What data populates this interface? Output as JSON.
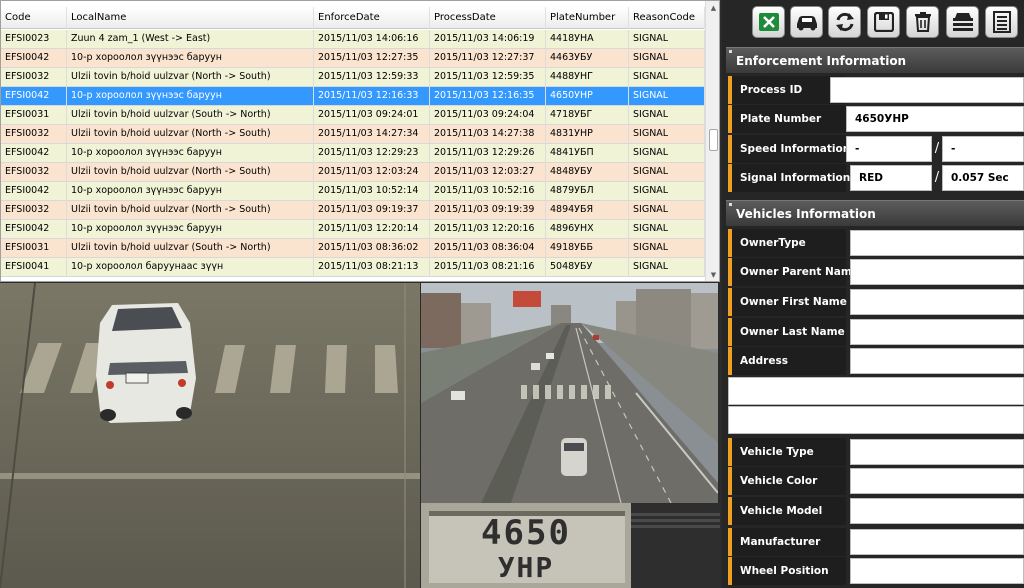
{
  "table": {
    "columns": [
      "Code",
      "LocalName",
      "EnforceDate",
      "ProcessDate",
      "PlateNumber",
      "ReasonCode"
    ],
    "rows": [
      [
        "EFSI0023",
        "Zuun 4 zam_1 (West -> East)",
        "2015/11/03 14:06:16",
        "2015/11/03 14:06:19",
        "4418УНА",
        "SIGNAL"
      ],
      [
        "EFSI0042",
        "10-р хороолол зүүнээс баруун",
        "2015/11/03 12:27:35",
        "2015/11/03 12:27:37",
        "4463УБУ",
        "SIGNAL"
      ],
      [
        "EFSI0032",
        "Ulzii tovin b/hoid uulzvar (North -> South)",
        "2015/11/03 12:59:33",
        "2015/11/03 12:59:35",
        "4488УНГ",
        "SIGNAL"
      ],
      [
        "EFSI0042",
        "10-р хороолол зүүнээс баруун",
        "2015/11/03 12:16:33",
        "2015/11/03 12:16:35",
        "4650УНР",
        "SIGNAL"
      ],
      [
        "EFSI0031",
        "Ulzii tovin b/hoid uulzvar (South -> North)",
        "2015/11/03 09:24:01",
        "2015/11/03 09:24:04",
        "4718УБГ",
        "SIGNAL"
      ],
      [
        "EFSI0032",
        "Ulzii tovin b/hoid uulzvar (North -> South)",
        "2015/11/03 14:27:34",
        "2015/11/03 14:27:38",
        "4831УНР",
        "SIGNAL"
      ],
      [
        "EFSI0042",
        "10-р хороолол зүүнээс баруун",
        "2015/11/03 12:29:23",
        "2015/11/03 12:29:26",
        "4841УБП",
        "SIGNAL"
      ],
      [
        "EFSI0032",
        "Ulzii tovin b/hoid uulzvar (North -> South)",
        "2015/11/03 12:03:24",
        "2015/11/03 12:03:27",
        "4848УБУ",
        "SIGNAL"
      ],
      [
        "EFSI0042",
        "10-р хороолол зүүнээс баруун",
        "2015/11/03 10:52:14",
        "2015/11/03 10:52:16",
        "4879УБЛ",
        "SIGNAL"
      ],
      [
        "EFSI0032",
        "Ulzii tovin b/hoid uulzvar (North -> South)",
        "2015/11/03 09:19:37",
        "2015/11/03 09:19:39",
        "4894УБЯ",
        "SIGNAL"
      ],
      [
        "EFSI0042",
        "10-р хороолол зүүнээс баруун",
        "2015/11/03 12:20:14",
        "2015/11/03 12:20:16",
        "4896УНХ",
        "SIGNAL"
      ],
      [
        "EFSI0031",
        "Ulzii tovin b/hoid uulzvar (South -> North)",
        "2015/11/03 08:36:02",
        "2015/11/03 08:36:04",
        "4918УББ",
        "SIGNAL"
      ],
      [
        "EFSI0041",
        "10-р хороолол баруунаас зүүн",
        "2015/11/03 08:21:13",
        "2015/11/03 08:21:16",
        "5048УБУ",
        "SIGNAL"
      ]
    ],
    "selected_row": 3
  },
  "plate_crop": {
    "digits": "4650",
    "letters": "УНР"
  },
  "toolbar": [
    "excel-icon",
    "car-icon",
    "refresh-icon",
    "save-icon",
    "trash-icon",
    "vehicle-db-icon",
    "list-icon"
  ],
  "enforcement": {
    "title": "Enforcement Information",
    "process_id_label": "Process ID",
    "process_id": "",
    "plate_label": "Plate Number",
    "plate": "4650УНР",
    "speed_label": "Speed Information",
    "speed_value": "-",
    "speed_limit": "-",
    "signal_label": "Signal Information",
    "signal_value": "RED",
    "signal_time": "0.057 Sec",
    "separator": "/"
  },
  "vehicles": {
    "title": "Vehicles Information",
    "owner_type_label": "OwnerType",
    "owner_parent_label": "Owner Parent Name",
    "owner_first_label": "Owner First Name",
    "owner_last_label": "Owner Last Name",
    "address_label": "Address",
    "vehicle_type_label": "Vehicle Type",
    "vehicle_color_label": "Vehicle Color",
    "vehicle_model_label": "Vehicle Model",
    "manufacturer_label": "Manufacturer",
    "wheel_position_label": "Wheel Position"
  },
  "colors": {
    "accent": "#f0a020",
    "selection": "#3399ff",
    "row_odd": "#f0f3d6",
    "row_even": "#fbe4cf",
    "panel": "#262626"
  }
}
